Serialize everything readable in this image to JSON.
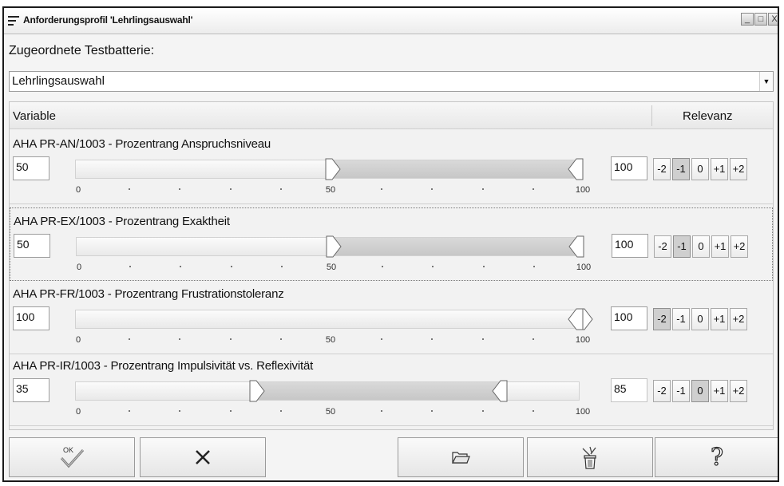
{
  "window": {
    "title": "Anforderungsprofil 'Lehrlingsauswahl'",
    "controls": [
      "_",
      "□",
      "X"
    ]
  },
  "battery": {
    "label": "Zugeordnete Testbatterie:",
    "selected": "Lehrlingsauswahl",
    "arrow": "▼"
  },
  "list": {
    "header_variable": "Variable",
    "header_relevanz": "Relevanz",
    "tick_labels": [
      "0",
      "50",
      "100"
    ],
    "relevance_options": [
      "-2",
      "-1",
      "0",
      "+1",
      "+2"
    ],
    "rows": [
      {
        "label": "AHA PR-AN/1003 - Prozentrang Anspruchsniveau",
        "min": "50",
        "max": "100",
        "relevance": "-1",
        "min_value": 50,
        "max_value": 100
      },
      {
        "label": "AHA PR-EX/1003 - Prozentrang Exaktheit",
        "min": "50",
        "max": "100",
        "relevance": "-1",
        "min_value": 50,
        "max_value": 100
      },
      {
        "label": "AHA PR-FR/1003 - Prozentrang Frustrationstoleranz",
        "min": "100",
        "max": "100",
        "relevance": "-2",
        "min_value": 100,
        "max_value": 100
      },
      {
        "label": "AHA PR-IR/1003 - Prozentrang Impulsivität vs. Reflexivität",
        "min": "35",
        "max": "85",
        "relevance": "0",
        "min_value": 35,
        "max_value": 85
      }
    ]
  },
  "footer": {
    "buttons": [
      {
        "name": "ok-button",
        "icon": "ok-check-icon",
        "glyph": "OK"
      },
      {
        "name": "cancel-button",
        "icon": "x-icon"
      },
      {
        "name": "open-button",
        "icon": "folder-open-icon"
      },
      {
        "name": "delete-button",
        "icon": "trash-icon"
      },
      {
        "name": "help-button",
        "icon": "question-icon",
        "glyph": "?"
      }
    ]
  }
}
